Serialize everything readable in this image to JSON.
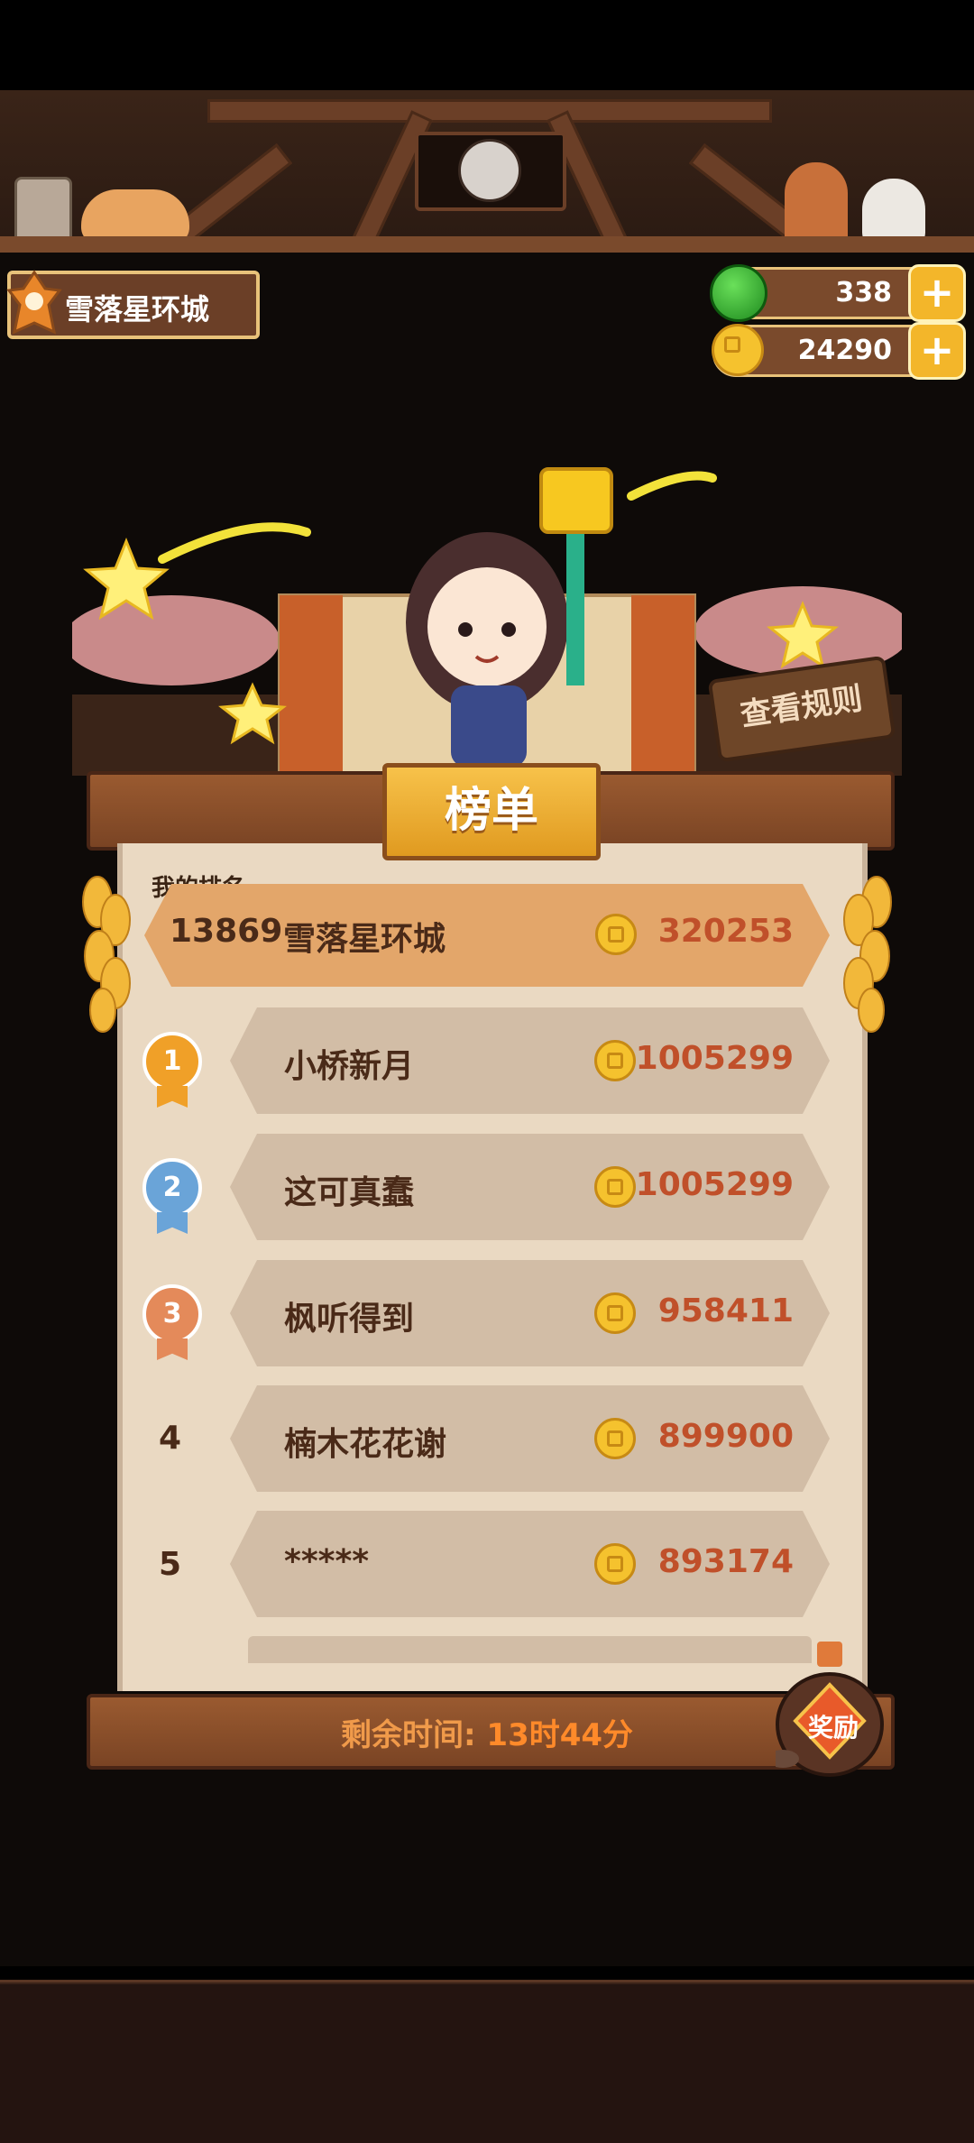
{
  "player": {
    "city_name": "雪落星环城"
  },
  "currencies": [
    {
      "icon": "green-apple-icon",
      "value": "338"
    },
    {
      "icon": "gold-coin-icon",
      "value": "24290"
    }
  ],
  "board": {
    "title": "榜单",
    "rules_button": "查看规则",
    "my_rank_label": "我的排名",
    "my_rank": {
      "rank": "13869",
      "name": "雪落星环城",
      "score": "320253"
    },
    "rows": [
      {
        "rank": "1",
        "name": "小桥新月",
        "score": "1005299",
        "medal": "gold"
      },
      {
        "rank": "2",
        "name": "这可真蠢",
        "score": "1005299",
        "medal": "silver"
      },
      {
        "rank": "3",
        "name": "枫听得到",
        "score": "958411",
        "medal": "bronze"
      },
      {
        "rank": "4",
        "name": "楠木花花谢",
        "score": "899900",
        "medal": ""
      },
      {
        "rank": "5",
        "name": "*****",
        "score": "893174",
        "medal": ""
      }
    ],
    "timer_label": "剩余时间:",
    "timer_value": "13时44分",
    "reward_button": "奖励"
  },
  "colors": {
    "accent": "#f3b62a",
    "score": "#c0502a",
    "paper": "#ead9c2",
    "wood": "#7a4424"
  }
}
